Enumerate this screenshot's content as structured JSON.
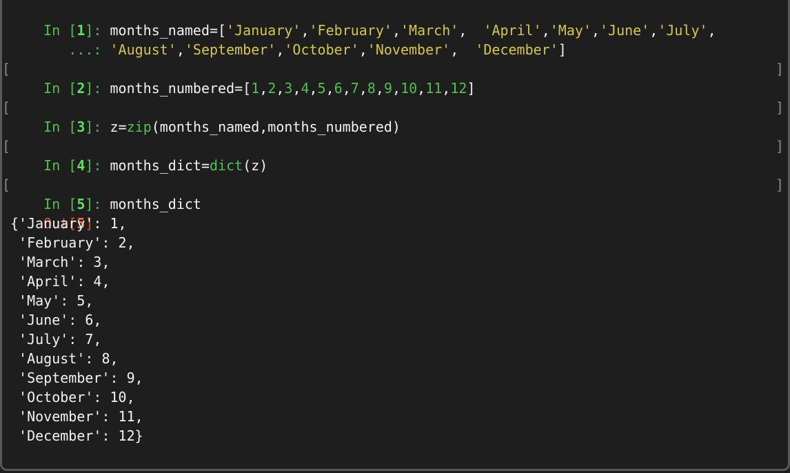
{
  "cells": [
    {
      "prompt_in": "In ",
      "number": "1",
      "prompt_end": "]: ",
      "code_segments": [
        {
          "t": "months_named=[",
          "c": "plain"
        },
        {
          "t": "'January'",
          "c": "str"
        },
        {
          "t": ",",
          "c": "plain"
        },
        {
          "t": "'February'",
          "c": "str"
        },
        {
          "t": ",",
          "c": "plain"
        },
        {
          "t": "'March'",
          "c": "str"
        },
        {
          "t": ",  ",
          "c": "plain"
        },
        {
          "t": "'April'",
          "c": "str"
        },
        {
          "t": ",",
          "c": "plain"
        },
        {
          "t": "'May'",
          "c": "str"
        },
        {
          "t": ",",
          "c": "plain"
        },
        {
          "t": "'June'",
          "c": "str"
        },
        {
          "t": ",",
          "c": "plain"
        },
        {
          "t": "'July'",
          "c": "str"
        },
        {
          "t": ",",
          "c": "plain"
        }
      ],
      "continuation_prompt": "   ...: ",
      "continuation_segments": [
        {
          "t": "'August'",
          "c": "str"
        },
        {
          "t": ",",
          "c": "plain"
        },
        {
          "t": "'September'",
          "c": "str"
        },
        {
          "t": ",",
          "c": "plain"
        },
        {
          "t": "'October'",
          "c": "str"
        },
        {
          "t": ",",
          "c": "plain"
        },
        {
          "t": "'November'",
          "c": "str"
        },
        {
          "t": ",  ",
          "c": "plain"
        },
        {
          "t": "'December'",
          "c": "str"
        },
        {
          "t": "]",
          "c": "plain"
        }
      ]
    },
    {
      "prompt_in": "In ",
      "number": "2",
      "prompt_end": "]: ",
      "code_segments": [
        {
          "t": "months_numbered=[",
          "c": "plain"
        },
        {
          "t": "1",
          "c": "num"
        },
        {
          "t": ",",
          "c": "plain"
        },
        {
          "t": "2",
          "c": "num"
        },
        {
          "t": ",",
          "c": "plain"
        },
        {
          "t": "3",
          "c": "num"
        },
        {
          "t": ",",
          "c": "plain"
        },
        {
          "t": "4",
          "c": "num"
        },
        {
          "t": ",",
          "c": "plain"
        },
        {
          "t": "5",
          "c": "num"
        },
        {
          "t": ",",
          "c": "plain"
        },
        {
          "t": "6",
          "c": "num"
        },
        {
          "t": ",",
          "c": "plain"
        },
        {
          "t": "7",
          "c": "num"
        },
        {
          "t": ",",
          "c": "plain"
        },
        {
          "t": "8",
          "c": "num"
        },
        {
          "t": ",",
          "c": "plain"
        },
        {
          "t": "9",
          "c": "num"
        },
        {
          "t": ",",
          "c": "plain"
        },
        {
          "t": "10",
          "c": "num"
        },
        {
          "t": ",",
          "c": "plain"
        },
        {
          "t": "11",
          "c": "num"
        },
        {
          "t": ",",
          "c": "plain"
        },
        {
          "t": "12",
          "c": "num"
        },
        {
          "t": "]",
          "c": "plain"
        }
      ]
    },
    {
      "prompt_in": "In ",
      "number": "3",
      "prompt_end": "]: ",
      "code_segments": [
        {
          "t": "z=",
          "c": "plain"
        },
        {
          "t": "zip",
          "c": "bi"
        },
        {
          "t": "(months_named,months_numbered)",
          "c": "plain"
        }
      ]
    },
    {
      "prompt_in": "In ",
      "number": "4",
      "prompt_end": "]: ",
      "code_segments": [
        {
          "t": "months_dict=",
          "c": "plain"
        },
        {
          "t": "dict",
          "c": "bi"
        },
        {
          "t": "(z)",
          "c": "plain"
        }
      ]
    },
    {
      "prompt_in": "In ",
      "number": "5",
      "prompt_end": "]: ",
      "code_segments": [
        {
          "t": "months_dict",
          "c": "plain"
        }
      ]
    }
  ],
  "output": {
    "prompt_out": "Out[",
    "number": "5",
    "prompt_end": "]:",
    "lines": [
      "{'January': 1,",
      " 'February': 2,",
      " 'March': 3,",
      " 'April': 4,",
      " 'May': 5,",
      " 'June': 6,",
      " 'July': 7,",
      " 'August': 8,",
      " 'September': 9,",
      " 'October': 10,",
      " 'November': 11,",
      " 'December': 12}"
    ]
  },
  "colors": {
    "background": "#1e1e1e",
    "prompt_green": "#4fc24f",
    "string_yellow": "#d6c74a",
    "out_red": "#d9542e",
    "text": "#f2f2f2"
  }
}
